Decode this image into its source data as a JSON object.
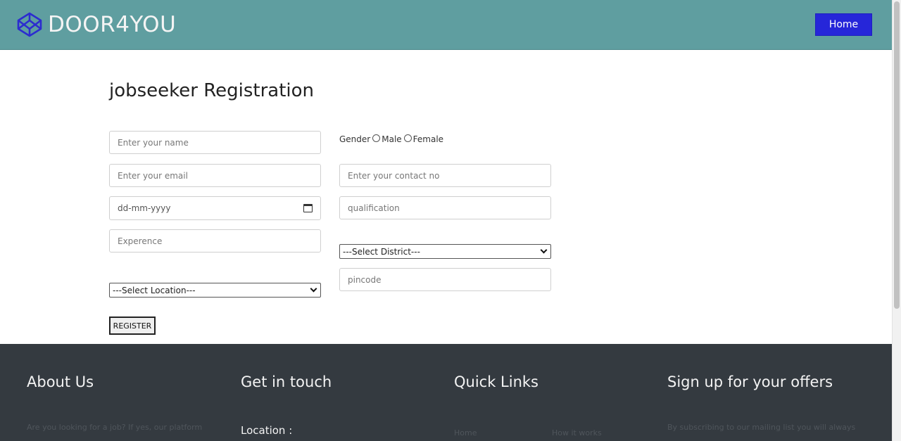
{
  "header": {
    "brand_name": "DOOR4YOU",
    "brand_icon": "codepen-cube-icon",
    "home_label": "Home"
  },
  "form": {
    "title": "jobseeker Registration",
    "name_placeholder": "Enter your name",
    "email_placeholder": "Enter your email",
    "dob_placeholder": "dd-mm-yyyy",
    "experience_placeholder": "Experence",
    "location_select": "---Select Location---",
    "gender_label": "Gender",
    "gender_male": "Male",
    "gender_female": "Female",
    "contact_placeholder": "Enter your contact no",
    "qualification_placeholder": "qualification",
    "district_select": "---Select District---",
    "pincode_placeholder": "pincode",
    "register_label": "REGISTER"
  },
  "footer": {
    "about_title": "About Us",
    "about_text": "Are you looking for a job? If yes, our platform",
    "contact_title": "Get in touch",
    "location_label": "Location :",
    "links_title": "Quick Links",
    "link_home": "Home",
    "link_how": "How it works",
    "offers_title": "Sign up for your offers",
    "offers_text": "By subscribing to our mailing list you will always"
  },
  "colors": {
    "header_bg": "#5f9ea0",
    "home_button": "#2626d9",
    "footer_bg": "#343a40"
  }
}
